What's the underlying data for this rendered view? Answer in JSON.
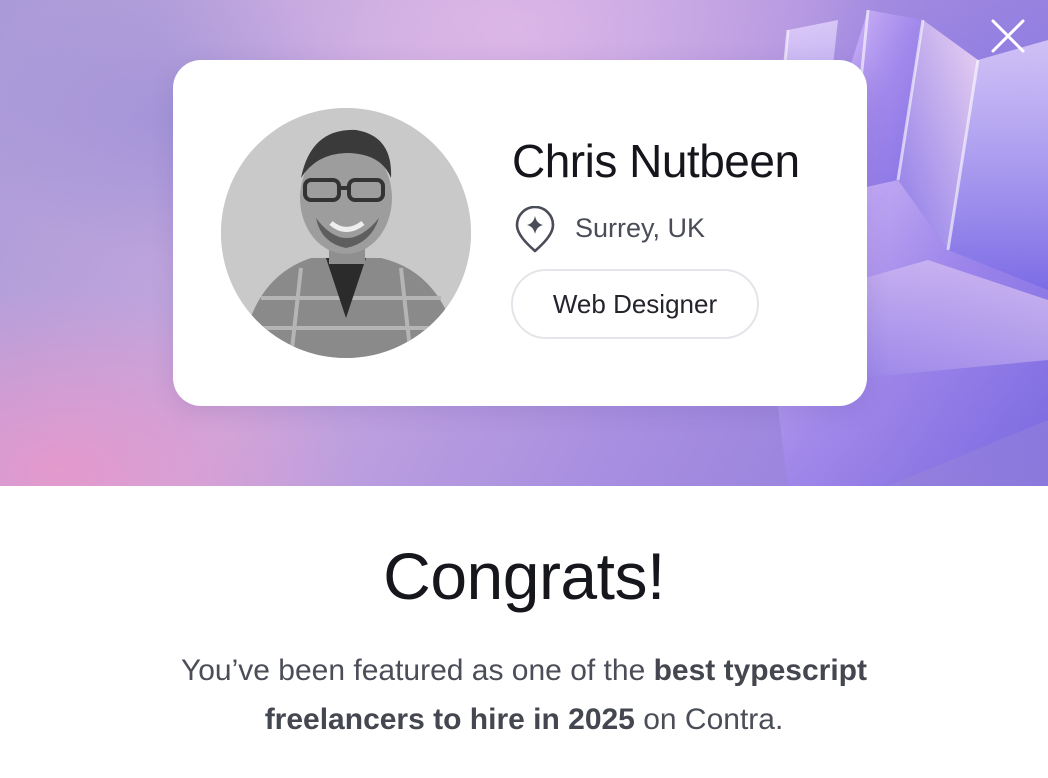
{
  "modal": {
    "close_icon": "close-icon",
    "colors": {
      "accent_bg": "#a99ad8",
      "card_bg": "#ffffff",
      "text": "#16161d",
      "muted": "#4b4e58"
    }
  },
  "profile": {
    "name": "Chris Nutbeen",
    "location_icon": "location-pin-sparkle-icon",
    "location": "Surrey, UK",
    "role": "Web Designer"
  },
  "congrats": {
    "heading": "Congrats!",
    "message_prefix": "You’ve been featured as one of the ",
    "message_bold": "best typescript freelancers to hire in 2025",
    "message_suffix": " on Contra."
  }
}
